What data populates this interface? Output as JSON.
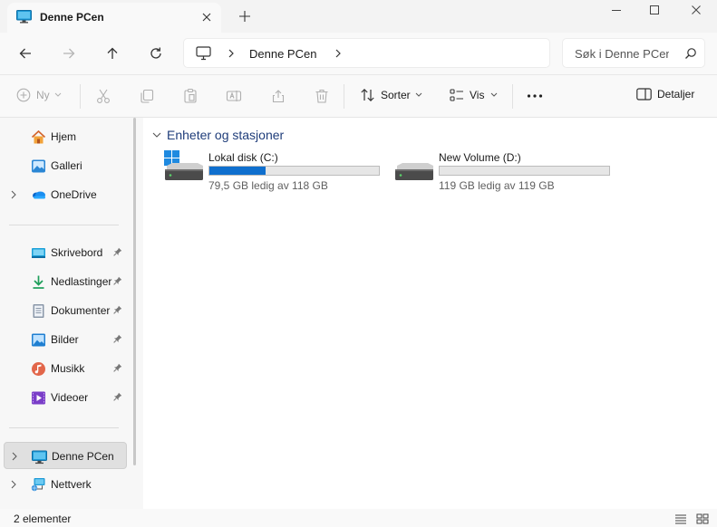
{
  "window": {
    "tab_title": "Denne PCen",
    "tab_icon": "monitor-icon",
    "controls": [
      "minimize-icon",
      "maximize-icon",
      "close-icon"
    ]
  },
  "nav": {
    "breadcrumb": [
      "Denne PCen"
    ],
    "search_placeholder": "Søk i Denne PCen"
  },
  "commands": {
    "new_label": "Ny",
    "sort_label": "Sorter",
    "view_label": "Vis",
    "details_label": "Detaljer"
  },
  "sidebar": {
    "quick": [
      {
        "label": "Hjem",
        "icon": "home-icon"
      },
      {
        "label": "Galleri",
        "icon": "gallery-icon"
      },
      {
        "label": "OneDrive",
        "icon": "onedrive-icon"
      }
    ],
    "pinned": [
      {
        "label": "Skrivebord",
        "icon": "desktop-folder-icon"
      },
      {
        "label": "Nedlastinger",
        "icon": "downloads-icon"
      },
      {
        "label": "Dokumenter",
        "icon": "documents-icon"
      },
      {
        "label": "Bilder",
        "icon": "pictures-icon"
      },
      {
        "label": "Musikk",
        "icon": "music-icon"
      },
      {
        "label": "Videoer",
        "icon": "videos-icon"
      }
    ],
    "locations": [
      {
        "label": "Denne PCen",
        "icon": "monitor-icon",
        "selected": true
      },
      {
        "label": "Nettverk",
        "icon": "network-icon"
      }
    ]
  },
  "main": {
    "group_title": "Enheter og stasjoner",
    "drives": [
      {
        "name": "Lokal disk (C:)",
        "free_text": "79,5 GB ledig av 118 GB",
        "used_fraction": 0.33,
        "icon": "system-drive-icon"
      },
      {
        "name": "New Volume (D:)",
        "free_text": "119 GB ledig av 119 GB",
        "used_fraction": 0.0,
        "icon": "drive-icon"
      }
    ]
  },
  "status": {
    "item_count": "2 elementer"
  },
  "colors": {
    "accent": "#0f6fce",
    "group_header": "#1f3d7a"
  }
}
